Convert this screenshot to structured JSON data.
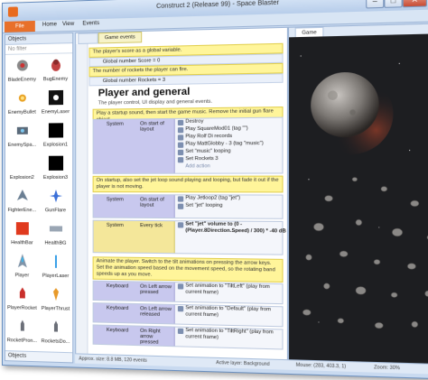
{
  "window": {
    "title": "Construct 2 (Release 99) - Space Blaster",
    "min_label": "–",
    "max_label": "□",
    "close_label": "✕"
  },
  "ribbon": {
    "file_label": "File",
    "tabs": [
      "Home",
      "View",
      "Events"
    ]
  },
  "objects_panel": {
    "title": "Objects",
    "filter_placeholder": "No filter",
    "footer": "Objects",
    "items": [
      {
        "label": "BladeEnemy",
        "icon": "blade-enemy-icon"
      },
      {
        "label": "BugEnemy",
        "icon": "bug-enemy-icon"
      },
      {
        "label": "EnemyBullet",
        "icon": "enemy-bullet-icon"
      },
      {
        "label": "EnemyLaser",
        "icon": "enemy-laser-icon"
      },
      {
        "label": "EnemySpa...",
        "icon": "enemy-spawner-icon"
      },
      {
        "label": "Explosion1",
        "icon": "explosion-icon"
      },
      {
        "label": "Explosion2",
        "icon": "explosion-icon"
      },
      {
        "label": "Explosion3",
        "icon": "explosion-icon"
      },
      {
        "label": "FighterEne...",
        "icon": "fighter-enemy-icon"
      },
      {
        "label": "GunFlare",
        "icon": "gun-flare-icon"
      },
      {
        "label": "HealthBar",
        "icon": "health-bar-icon"
      },
      {
        "label": "HealthBG",
        "icon": "health-bg-icon"
      },
      {
        "label": "Player",
        "icon": "player-ship-icon"
      },
      {
        "label": "PlayerLaser",
        "icon": "player-laser-icon"
      },
      {
        "label": "PlayerRocket",
        "icon": "player-rocket-icon"
      },
      {
        "label": "PlayerThrust",
        "icon": "player-thrust-icon"
      },
      {
        "label": "RocketPron...",
        "icon": "rocket-icon"
      },
      {
        "label": "RocketsDo...",
        "icon": "rocket-icon"
      }
    ]
  },
  "event_sheet": {
    "tab_label": "Game events",
    "comments": [
      "The player's score as a global variable.",
      "The number of rockets the player can fire."
    ],
    "globals": [
      "Global number Score = 0",
      "Global number Rockets = 3"
    ],
    "group_title": "Player and general",
    "group_desc": "The player control, UI display and general events.",
    "comment_start": "Play a startup sound, then start the game music. Remove the initial gun flare object.",
    "event1": {
      "object": "System",
      "condition": "On start of layout",
      "actions": [
        "Destroy",
        "Play SquareMod01 (tag \"\")",
        "Play Rolf Di records",
        "Play MattGlobby - 3 (tag \"music\")",
        "Set \"music\" looping",
        "Set Rockets 3"
      ]
    },
    "comment_onstart": "On startup, also set the jet loop sound playing and looping, but fade it out if the player is not moving.",
    "event2": {
      "object": "System",
      "condition": "On start of layout",
      "actions": [
        "Play Jetloop2 (tag \"jet\")",
        "Set \"jet\" looping"
      ]
    },
    "event3": {
      "object": "System",
      "condition": "Every tick",
      "actions": [
        "Set \"jet\" volume to (0 - (Player.8Direction.Speed) / 300) * -40 dB"
      ]
    },
    "comment_animate": "Animate the player. Switch to the tilt animations on pressing the arrow keys. Set the animation speed based on the movement speed, so the rotating band speeds up as you move.",
    "event4": {
      "object": "Keyboard",
      "condition": "On Left arrow pressed",
      "action": "Set animation to \"TiltLeft\" (play from current frame)"
    },
    "event5": {
      "object": "Keyboard",
      "condition": "On Left arrow released",
      "action": "Set animation to \"Default\" (play from current frame)"
    },
    "event6": {
      "object": "Keyboard",
      "condition": "On Right arrow pressed",
      "action": "Set animation to \"TiltRight\" (play from current frame)"
    },
    "add_action": "Add action"
  },
  "game_view": {
    "tab_label": "Game"
  },
  "status_bar": {
    "approx": "Approx. size: 8.8 MB, 120 events",
    "layer": "Active layer: Background",
    "mouse": "Mouse: (283, 403.3, 1)",
    "zoom": "Zoom: 30%"
  },
  "colors": {
    "accent": "#e8702a",
    "comment": "#fff59a",
    "condition": "#c8c8ee"
  }
}
